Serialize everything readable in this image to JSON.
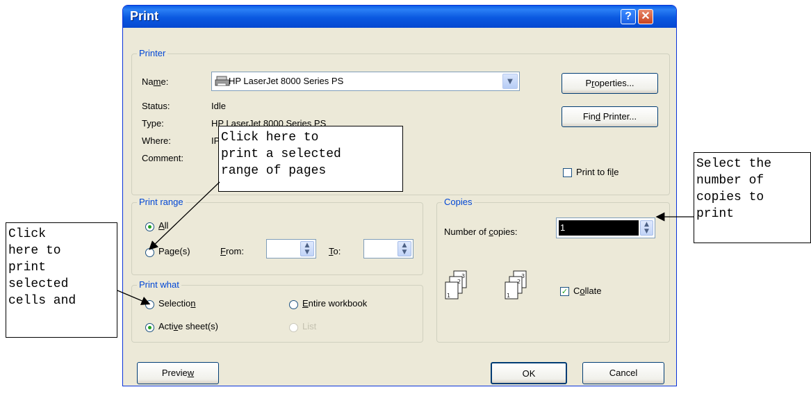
{
  "window": {
    "title": "Print",
    "help_glyph": "?",
    "close_glyph": "✕"
  },
  "printer": {
    "group_label": "Printer",
    "name_label": "Name:",
    "name_value": "HP LaserJet 8000 Series PS",
    "status_label": "Status:",
    "status_value": "Idle",
    "type_label": "Type:",
    "type_value": "HP LaserJet 8000 Series PS",
    "where_label": "Where:",
    "where_value": "IP",
    "comment_label": "Comment:",
    "properties_button": "Properties...",
    "find_printer_button": "Find Printer...",
    "print_to_file_label": "Print to file",
    "print_to_file_checked": false
  },
  "print_range": {
    "group_label": "Print range",
    "all_label": "All",
    "pages_label": "Page(s)",
    "from_label": "From:",
    "to_label": "To:",
    "selected": "all"
  },
  "print_what": {
    "group_label": "Print what",
    "selection_label": "Selection",
    "entire_workbook_label": "Entire workbook",
    "active_sheets_label": "Active sheet(s)",
    "list_label": "List",
    "selected": "active_sheets"
  },
  "copies": {
    "group_label": "Copies",
    "number_label": "Number of copies:",
    "number_value": "1",
    "collate_label": "Collate",
    "collate_checked": true
  },
  "footer": {
    "preview_button": "Preview",
    "ok_button": "OK",
    "cancel_button": "Cancel"
  },
  "callouts": {
    "pages": [
      "Click here to",
      "print a selected",
      "range of pages"
    ],
    "copies": [
      "Select the",
      "number of",
      "copies to",
      "print"
    ],
    "selection": [
      "Click",
      "here to",
      "print",
      "selected",
      "cells and"
    ]
  },
  "colors": {
    "title_bar": "#0a5ce6",
    "group_label": "#0046d5",
    "dialog_face": "#ece9d8"
  }
}
